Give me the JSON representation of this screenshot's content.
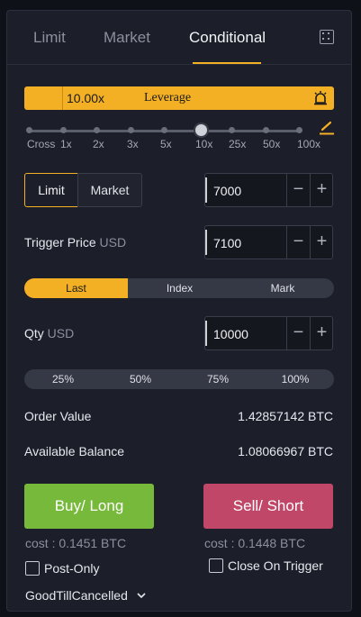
{
  "tabs": [
    {
      "label": "Limit"
    },
    {
      "label": "Market"
    },
    {
      "label": "Conditional",
      "active": true
    }
  ],
  "leverage": {
    "value": "10.00x",
    "label": "Leverage",
    "position_fraction": 0.64
  },
  "slider_labels": [
    "Cross",
    "1x",
    "2x",
    "3x",
    "5x",
    "10x",
    "25x",
    "50x",
    "100x"
  ],
  "order_type": {
    "limit": "Limit",
    "market": "Market",
    "selected": "Limit"
  },
  "price": {
    "value": "7000",
    "minus": "−",
    "plus": "+"
  },
  "trigger": {
    "label": "Trigger Price",
    "unit": "USD",
    "value": "7100",
    "minus": "−",
    "plus": "+"
  },
  "trigger_source": {
    "options": [
      "Last",
      "Index",
      "Mark"
    ],
    "selected": "Last"
  },
  "qty": {
    "label": "Qty",
    "unit": "USD",
    "value": "10000",
    "minus": "−",
    "plus": "+"
  },
  "percent_options": [
    "25%",
    "50%",
    "75%",
    "100%"
  ],
  "order_value": {
    "label": "Order Value",
    "value": "1.42857142 BTC"
  },
  "available_balance": {
    "label": "Available Balance",
    "value": "1.08066967 BTC"
  },
  "buy": {
    "label": "Buy/ Long",
    "cost": "cost : 0.1451 BTC"
  },
  "sell": {
    "label": "Sell/ Short",
    "cost": "cost : 0.1448 BTC"
  },
  "post_only": {
    "label": "Post-Only",
    "checked": false
  },
  "close_on_trigger": {
    "label": "Close On Trigger",
    "checked": false
  },
  "time_in_force": {
    "value": "GoodTillCancelled"
  },
  "colors": {
    "accent": "#f3b025",
    "buy": "#77b93b",
    "sell": "#c14768",
    "panel": "#1c1e29"
  }
}
